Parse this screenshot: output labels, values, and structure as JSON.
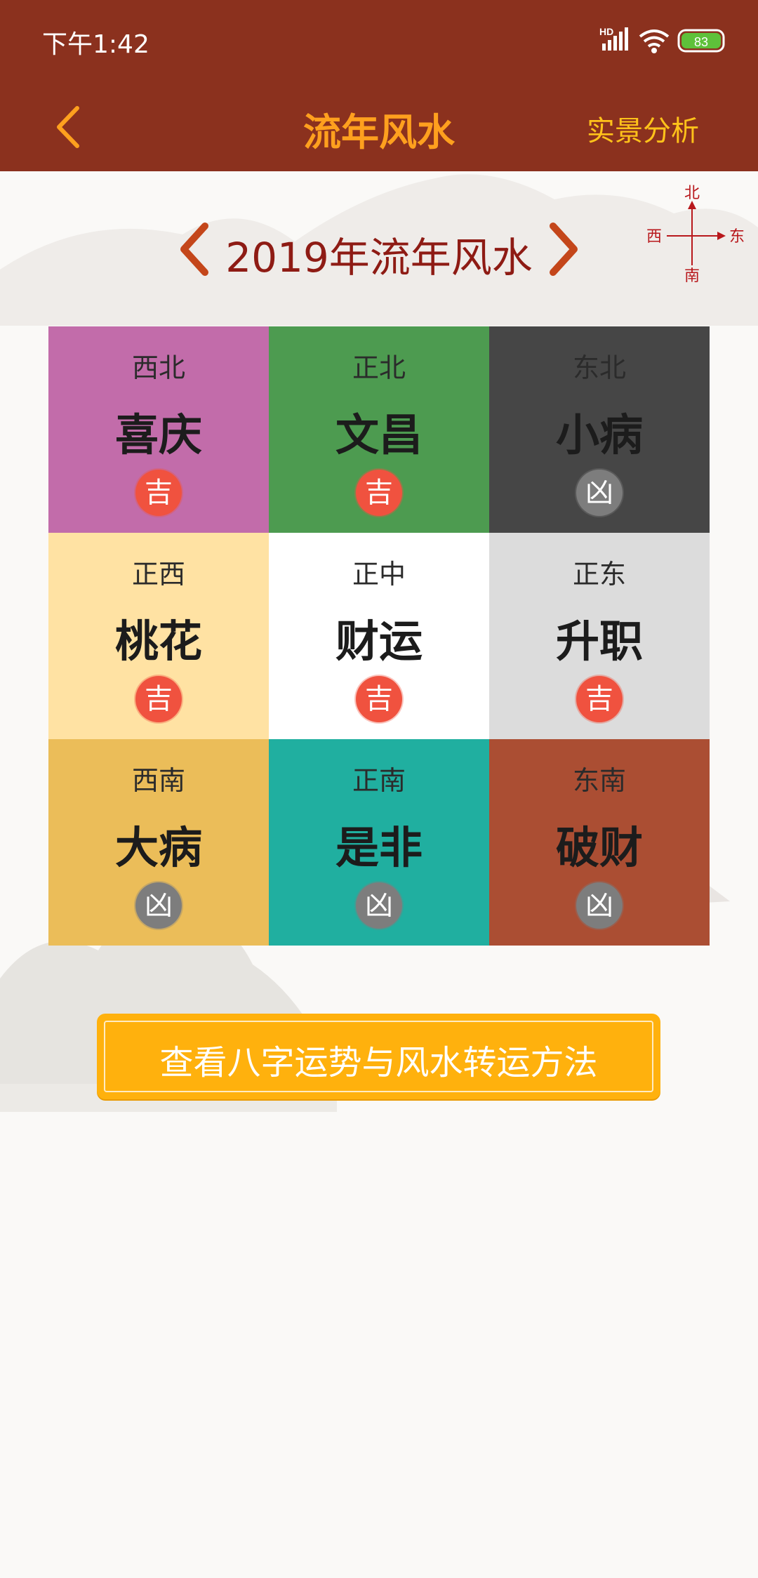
{
  "status_bar": {
    "time": "下午1:42",
    "signal_label": "HD",
    "battery": "83",
    "battery_color": "#5ec13a"
  },
  "nav": {
    "back_icon": "chevron-left-icon",
    "title": "流年风水",
    "right_action": "实景分析"
  },
  "year_selector": {
    "title": "2019年流年风水",
    "prev_icon": "chevron-left-icon",
    "next_icon": "chevron-right-icon"
  },
  "compass": {
    "north": "北",
    "south": "南",
    "west": "西",
    "east": "东",
    "color": "#b8181c"
  },
  "grid": {
    "cells": [
      {
        "direction": "西北",
        "name": "喜庆",
        "badge": "吉",
        "luck": "good",
        "color": "#c26caa"
      },
      {
        "direction": "正北",
        "name": "文昌",
        "badge": "吉",
        "luck": "good",
        "color": "#4d9b50"
      },
      {
        "direction": "东北",
        "name": "小病",
        "badge": "凶",
        "luck": "bad",
        "color": "#464646"
      },
      {
        "direction": "正西",
        "name": "桃花",
        "badge": "吉",
        "luck": "good",
        "color": "#ffe2a3"
      },
      {
        "direction": "正中",
        "name": "财运",
        "badge": "吉",
        "luck": "good",
        "color": "#ffffff"
      },
      {
        "direction": "正东",
        "name": "升职",
        "badge": "吉",
        "luck": "good",
        "color": "#dcdcdc"
      },
      {
        "direction": "西南",
        "name": "大病",
        "badge": "凶",
        "luck": "bad",
        "color": "#ebbd59"
      },
      {
        "direction": "正南",
        "name": "是非",
        "badge": "凶",
        "luck": "bad",
        "color": "#20afa0"
      },
      {
        "direction": "东南",
        "name": "破财",
        "badge": "凶",
        "luck": "bad",
        "color": "#ab4e33"
      }
    ]
  },
  "cta": {
    "label": "查看八字运势与风水转运方法"
  }
}
